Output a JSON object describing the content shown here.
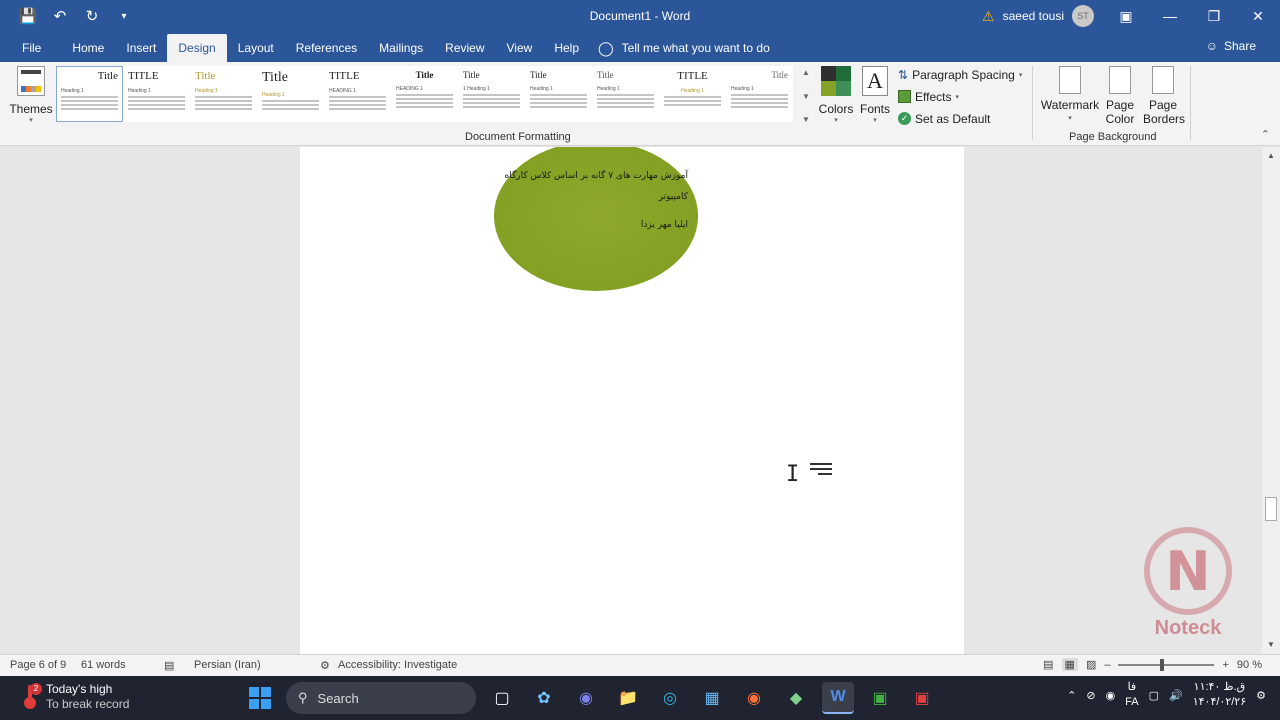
{
  "titlebar": {
    "title": "Document1  -  Word",
    "user_name": "saeed tousi",
    "user_initials": "ST"
  },
  "tabs": [
    {
      "label": "File"
    },
    {
      "label": "Home"
    },
    {
      "label": "Insert"
    },
    {
      "label": "Design",
      "active": true
    },
    {
      "label": "Layout"
    },
    {
      "label": "References"
    },
    {
      "label": "Mailings"
    },
    {
      "label": "Review"
    },
    {
      "label": "View"
    },
    {
      "label": "Help"
    }
  ],
  "tell_me": "Tell me what you want to do",
  "share_label": "Share",
  "ribbon": {
    "themes_label": "Themes",
    "style_gallery": [
      "Title",
      "TITLE",
      "Title",
      "Title",
      "TITLE",
      "Title",
      "Title",
      "Title",
      "Title",
      "TITLE",
      "Title"
    ],
    "colors_label": "Colors",
    "fonts_label": "Fonts",
    "paragraph_spacing_label": "Paragraph Spacing",
    "effects_label": "Effects",
    "set_default_label": "Set as Default",
    "watermark_label": "Watermark",
    "page_color_label": "Page Color",
    "page_borders_label": "Page Borders",
    "group_document_formatting": "Document Formatting",
    "group_page_background": "Page Background"
  },
  "document": {
    "oval_line1": "آموزش مهارت های ۷ گانه بر اساس کلاس کارگاه",
    "oval_line2": "کامپیوتر",
    "oval_line3": "ایلیا مهر یزدا",
    "oval_color": "#84a326",
    "watermark_text": "Noteck"
  },
  "status": {
    "page": "Page 6 of 9",
    "words": "61 words",
    "language": "Persian (Iran)",
    "accessibility": "Accessibility: Investigate",
    "zoom": "90 %"
  },
  "taskbar": {
    "weather_badge": "2",
    "weather_title": "Today's high",
    "weather_sub": "To break record",
    "search_label": "Search",
    "lang1": "فا",
    "lang2": "FA",
    "time": "۱۱:۴۰ ق.ظ",
    "date": "۱۴۰۴/۰۲/۲۶"
  }
}
